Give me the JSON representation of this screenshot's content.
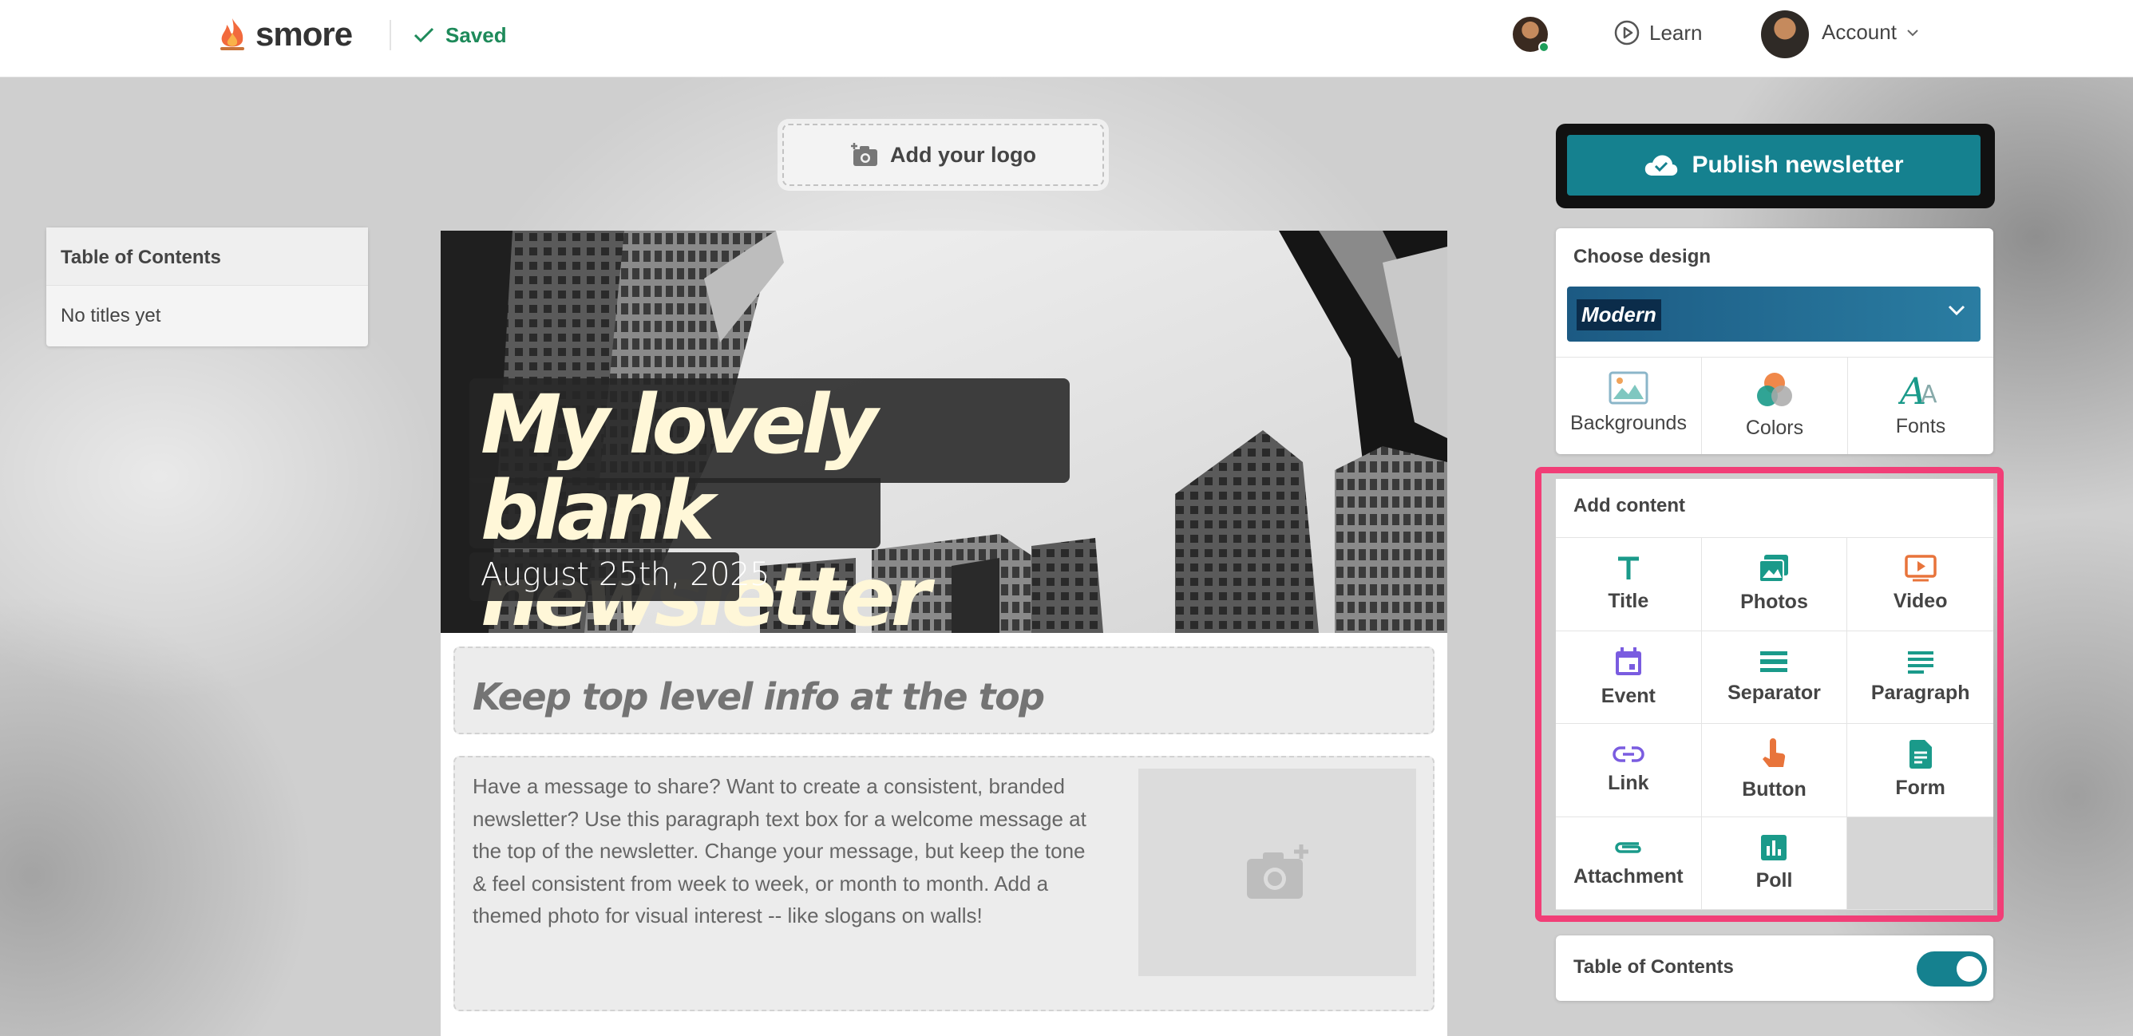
{
  "header": {
    "brand": "smore",
    "save_status": "Saved",
    "learn_label": "Learn",
    "account_label": "Account"
  },
  "editor": {
    "add_logo_label": "Add your logo",
    "toc_panel": {
      "title": "Table of Contents",
      "empty_text": "No titles yet"
    }
  },
  "newsletter": {
    "title": "My lovely blank newsletter",
    "date": "August 25th, 2025",
    "subtitle": "Keep top level info at the top",
    "paragraph": "Have a message to share? Want to create a consistent, branded newsletter? Use this paragraph text box for a welcome message at the top of the newsletter. Change your message, but keep the tone & feel consistent from week to week, or month to month. Add a themed photo for visual interest -- like slogans on walls!"
  },
  "sidebar": {
    "publish_label": "Publish newsletter",
    "design": {
      "title": "Choose design",
      "selected": "Modern",
      "options": [
        {
          "label": "Backgrounds",
          "icon": "image-icon"
        },
        {
          "label": "Colors",
          "icon": "palette-icon"
        },
        {
          "label": "Fonts",
          "icon": "fonts-icon"
        }
      ]
    },
    "content": {
      "title": "Add content",
      "items": [
        {
          "label": "Title",
          "icon": "title-icon",
          "color": "#1a9a8a"
        },
        {
          "label": "Photos",
          "icon": "photos-icon",
          "color": "#1a9a8a"
        },
        {
          "label": "Video",
          "icon": "video-icon",
          "color": "#e8743b"
        },
        {
          "label": "Event",
          "icon": "event-icon",
          "color": "#7a5ce0"
        },
        {
          "label": "Separator",
          "icon": "separator-icon",
          "color": "#1a9a8a"
        },
        {
          "label": "Paragraph",
          "icon": "paragraph-icon",
          "color": "#1a9a8a"
        },
        {
          "label": "Link",
          "icon": "link-icon",
          "color": "#7a5ce0"
        },
        {
          "label": "Button",
          "icon": "button-icon",
          "color": "#e8743b"
        },
        {
          "label": "Form",
          "icon": "form-icon",
          "color": "#1a9a8a"
        },
        {
          "label": "Attachment",
          "icon": "attachment-icon",
          "color": "#1a9a8a"
        },
        {
          "label": "Poll",
          "icon": "poll-icon",
          "color": "#1a9a8a"
        }
      ]
    },
    "toc_toggle": {
      "label": "Table of Contents",
      "enabled": true
    }
  },
  "colors": {
    "accent": "#15818f",
    "highlight": "#f13e77",
    "saved_green": "#1e8a5a"
  }
}
